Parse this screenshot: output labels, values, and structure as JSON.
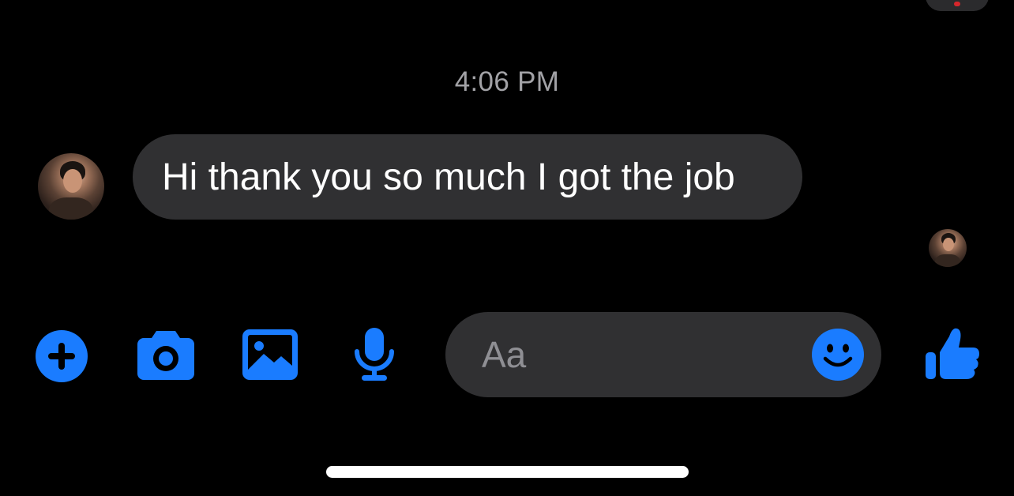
{
  "conversation": {
    "timestamp": "4:06 PM",
    "messages": [
      {
        "sender": "contact",
        "text": "Hi thank you so much I got the job"
      }
    ]
  },
  "composer": {
    "placeholder": "Aa",
    "value": ""
  },
  "icons": {
    "add": "plus-circle-icon",
    "camera": "camera-icon",
    "gallery": "photo-gallery-icon",
    "voice": "microphone-icon",
    "emoji": "smiley-icon",
    "like": "thumbs-up-icon"
  },
  "colors": {
    "accent": "#1a7cff",
    "bubble": "#303032",
    "background": "#000000",
    "timestamp": "#a2a2a6",
    "placeholder": "#8f8f94"
  }
}
